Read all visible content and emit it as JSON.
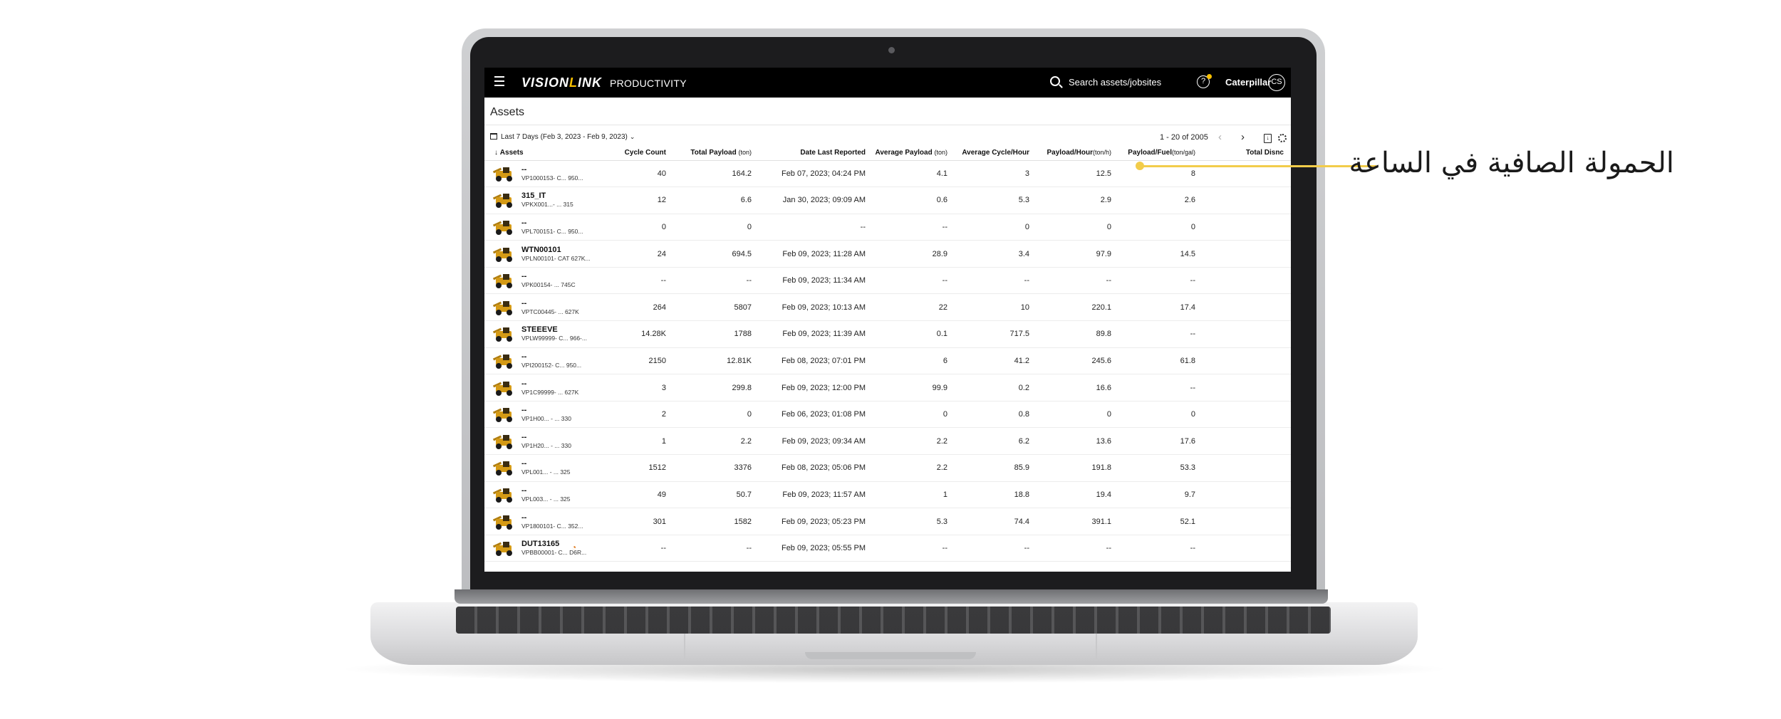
{
  "app": {
    "logo_main": "VISION",
    "logo_accent": "L",
    "logo_tail": "INK",
    "product": "PRODUCTIVITY",
    "search_placeholder": "Search assets/jobsites",
    "help_label": "?",
    "account": "Caterpillar",
    "avatar_initials": "CS"
  },
  "page": {
    "title": "Assets",
    "date_filter": "Last 7 Days (Feb 3, 2023 - Feb 9, 2023)",
    "pager": "1 - 20 of 2005",
    "prev_label": "‹",
    "next_label": "›"
  },
  "table": {
    "columns": [
      {
        "label": "Assets",
        "unit": ""
      },
      {
        "label": "Cycle Count",
        "unit": ""
      },
      {
        "label": "Total Payload",
        "unit": "(ton)"
      },
      {
        "label": "Date Last Reported",
        "unit": ""
      },
      {
        "label": "Average Payload",
        "unit": "(ton)"
      },
      {
        "label": "Average Cycle/Hour",
        "unit": ""
      },
      {
        "label": "Payload/Hour",
        "unit": "(ton/h)"
      },
      {
        "label": "Payload/Fuel",
        "unit": "(ton/gal)"
      },
      {
        "label": "Total Dis",
        "unit": "nc"
      }
    ],
    "rows": [
      {
        "name": "--",
        "sub": "VP1000153- C...   950...",
        "cycle": "40",
        "payload": "164.2",
        "date": "Feb 07, 2023; 04:24 PM",
        "avg_payload": "4.1",
        "avg_cycle": "3",
        "payload_hour": "12.5",
        "payload_fuel": "8",
        "total": ""
      },
      {
        "name": "315_IT",
        "sub": "VPKX001...- ...   315",
        "cycle": "12",
        "payload": "6.6",
        "date": "Jan 30, 2023; 09:09 AM",
        "avg_payload": "0.6",
        "avg_cycle": "5.3",
        "payload_hour": "2.9",
        "payload_fuel": "2.6",
        "total": ""
      },
      {
        "name": "--",
        "sub": "VPL700151- C...   950...",
        "cycle": "0",
        "payload": "0",
        "date": "--",
        "avg_payload": "--",
        "avg_cycle": "0",
        "payload_hour": "0",
        "payload_fuel": "0",
        "total": ""
      },
      {
        "name": "WTN00101",
        "sub": "VPLN00101- CAT  627K...",
        "cycle": "24",
        "payload": "694.5",
        "date": "Feb 09, 2023; 11:28 AM",
        "avg_payload": "28.9",
        "avg_cycle": "3.4",
        "payload_hour": "97.9",
        "payload_fuel": "14.5",
        "total": ""
      },
      {
        "name": "--",
        "sub": "VPK00154- ...   745C",
        "cycle": "--",
        "payload": "--",
        "date": "Feb 09, 2023; 11:34 AM",
        "avg_payload": "--",
        "avg_cycle": "--",
        "payload_hour": "--",
        "payload_fuel": "--",
        "total": ""
      },
      {
        "name": "--",
        "sub": "VPTC00445- ...   627K",
        "cycle": "264",
        "payload": "5807",
        "date": "Feb 09, 2023; 10:13 AM",
        "avg_payload": "22",
        "avg_cycle": "10",
        "payload_hour": "220.1",
        "payload_fuel": "17.4",
        "total": ""
      },
      {
        "name": "STEEEVE",
        "sub": "VPLW99999- C...   966-...",
        "cycle": "14.28K",
        "payload": "1788",
        "date": "Feb 09, 2023; 11:39 AM",
        "avg_payload": "0.1",
        "avg_cycle": "717.5",
        "payload_hour": "89.8",
        "payload_fuel": "--",
        "total": ""
      },
      {
        "name": "--",
        "sub": "VPI200152- C...   950...",
        "cycle": "2150",
        "payload": "12.81K",
        "date": "Feb 08, 2023; 07:01 PM",
        "avg_payload": "6",
        "avg_cycle": "41.2",
        "payload_hour": "245.6",
        "payload_fuel": "61.8",
        "total": ""
      },
      {
        "name": "--",
        "sub": "VP1C99999- ...   627K",
        "cycle": "3",
        "payload": "299.8",
        "date": "Feb 09, 2023; 12:00 PM",
        "avg_payload": "99.9",
        "avg_cycle": "0.2",
        "payload_hour": "16.6",
        "payload_fuel": "--",
        "total": ""
      },
      {
        "name": "--",
        "sub": "VP1H00... - ...   330",
        "cycle": "2",
        "payload": "0",
        "date": "Feb 06, 2023; 01:08 PM",
        "avg_payload": "0",
        "avg_cycle": "0.8",
        "payload_hour": "0",
        "payload_fuel": "0",
        "total": ""
      },
      {
        "name": "--",
        "sub": "VP1H20... - ...   330",
        "cycle": "1",
        "payload": "2.2",
        "date": "Feb 09, 2023; 09:34 AM",
        "avg_payload": "2.2",
        "avg_cycle": "6.2",
        "payload_hour": "13.6",
        "payload_fuel": "17.6",
        "total": ""
      },
      {
        "name": "--",
        "sub": "VPL001... - ...   325",
        "cycle": "1512",
        "payload": "3376",
        "date": "Feb 08, 2023; 05:06 PM",
        "avg_payload": "2.2",
        "avg_cycle": "85.9",
        "payload_hour": "191.8",
        "payload_fuel": "53.3",
        "total": ""
      },
      {
        "name": "--",
        "sub": "VPL003... - ...   325",
        "cycle": "49",
        "payload": "50.7",
        "date": "Feb 09, 2023; 11:57 AM",
        "avg_payload": "1",
        "avg_cycle": "18.8",
        "payload_hour": "19.4",
        "payload_fuel": "9.7",
        "total": ""
      },
      {
        "name": "--",
        "sub": "VP1800101- C...   352...",
        "cycle": "301",
        "payload": "1582",
        "date": "Feb 09, 2023; 05:23 PM",
        "avg_payload": "5.3",
        "avg_cycle": "74.4",
        "payload_hour": "391.1",
        "payload_fuel": "52.1",
        "total": ""
      },
      {
        "name": "DUT13165",
        "sub": "VPBB00001- C...   D6R...",
        "cycle": "--",
        "payload": "--",
        "date": "Feb 09, 2023; 05:55 PM",
        "avg_payload": "--",
        "avg_cycle": "--",
        "payload_hour": "--",
        "payload_fuel": "--",
        "total": ""
      }
    ]
  },
  "annotation": {
    "text": "الحمولة الصافية في الساعة",
    "color": "#f2cc4a"
  },
  "colors": {
    "brand_accent": "#f9c000",
    "topbar": "#000000",
    "wifi": "#e07a1c"
  },
  "icons": [
    "menu-icon",
    "search-icon",
    "help-icon",
    "calendar-icon",
    "chevron-down-icon",
    "chevron-left-icon",
    "chevron-right-icon",
    "export-icon",
    "settings-icon",
    "sort-down-icon",
    "wifi-icon"
  ]
}
